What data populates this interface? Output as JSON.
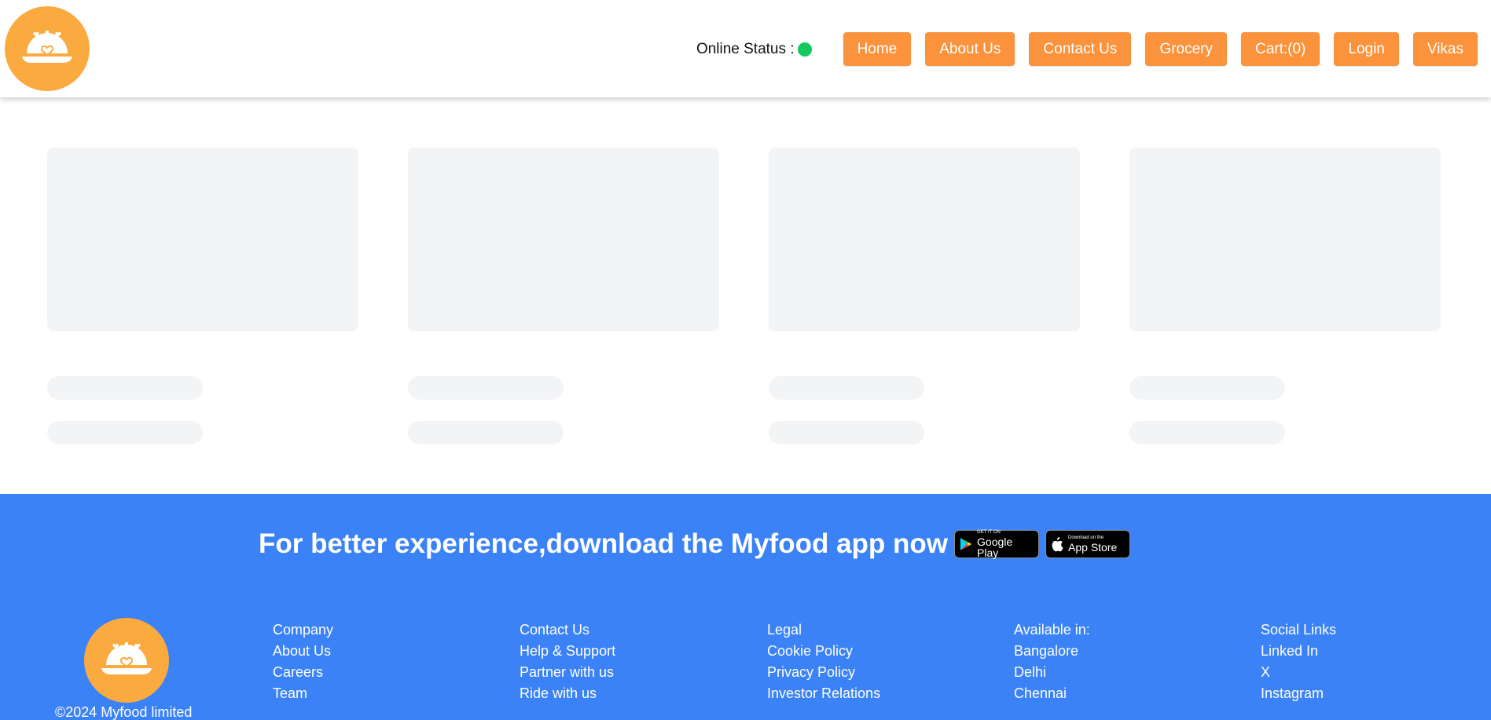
{
  "header": {
    "status_label": "Online Status :",
    "status_color": "#12c95c",
    "nav": [
      {
        "label": "Home"
      },
      {
        "label": "About Us"
      },
      {
        "label": "Contact Us"
      },
      {
        "label": "Grocery"
      },
      {
        "label": "Cart:(0)"
      },
      {
        "label": "Login"
      },
      {
        "label": "Vikas"
      }
    ]
  },
  "colors": {
    "brand_orange": "#fb923c",
    "logo_orange": "#fbaa3f",
    "footer_blue": "#3b82f6",
    "shimmer": "#f3f4f6"
  },
  "footer": {
    "promo_text": "For better experience,download the Myfood app now",
    "google_play": {
      "small": "GET IT ON",
      "big": "Google Play"
    },
    "app_store": {
      "small": "Download on the",
      "big": "App Store"
    },
    "copyright": "©2024 Myfood limited",
    "columns": [
      {
        "heading": "Company",
        "items": [
          "About Us",
          "Careers",
          "Team"
        ]
      },
      {
        "heading": "Contact Us",
        "items": [
          "Help & Support",
          "Partner with us",
          "Ride with us"
        ]
      },
      {
        "heading": "Legal",
        "items": [
          "Cookie Policy",
          "Privacy Policy",
          "Investor Relations"
        ]
      },
      {
        "heading": "Available in:",
        "items": [
          "Bangalore",
          "Delhi",
          "Chennai"
        ]
      },
      {
        "heading": "Social Links",
        "items": [
          "Linked In",
          "X",
          "Instagram"
        ]
      }
    ]
  }
}
